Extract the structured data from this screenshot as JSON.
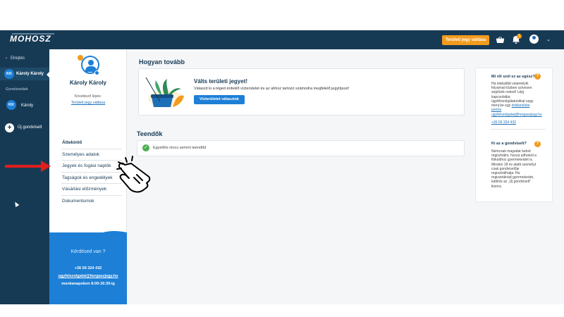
{
  "header": {
    "logo_text": "MOHOSZ",
    "cta_label": "Területi jegy váltása",
    "notification_count": "1",
    "icons": [
      "basket-icon",
      "bell-icon",
      "user-avatar-icon",
      "chevron-down-icon"
    ]
  },
  "rail": {
    "back_label": "Elrejtés",
    "active_user": {
      "initials": "KK",
      "name": "Károly Károly"
    },
    "section_label": "Gondviseltek",
    "ward": {
      "initials": "KK",
      "name": "Károly"
    },
    "add_label": "Új gondviselt"
  },
  "profile": {
    "name": "Károly Károly",
    "next_step_label": "Következő lépés:",
    "next_step_link": "Területi jegy váltása",
    "menu": [
      {
        "label": "Áttekintő",
        "active": true
      },
      {
        "label": "Személyes adatok",
        "active": false
      },
      {
        "label": "Jegyek és fogási naplók",
        "active": false
      },
      {
        "label": "Tagságok és engedélyek",
        "active": false
      },
      {
        "label": "Vásárlási előzmények",
        "active": false
      },
      {
        "label": "Dokumentumok",
        "active": false
      }
    ]
  },
  "help": {
    "title": "Kérdésed van ?",
    "phone": "+36 59 324 432",
    "email": "ugyfelszolgalat@horgaszjegy.hu",
    "hours": "munkanapokon 8:00-16:30-ig"
  },
  "main": {
    "next_title": "Hogyan tovább",
    "card_title": "Válts területi jegyet!",
    "card_text": "Válaszd ki a téged érdeklő vízterületet és az ahhoz tartozó számodra megfelelő jegytípust!",
    "card_button": "Vízterületet választok",
    "todo_title": "Teendők",
    "todo_text": "Egyelőre nincs semmi teendőd"
  },
  "info": {
    "q1_title": "Mi ről szól ez az egész?",
    "q1_text": "Ha elakadtál valamelyik folyamat közben szívesen segítünk neked! Lépj kapcsolatba ügyfélszolgálatunkkal vagy menj be egy ",
    "q1_link": "értékesítési pontra",
    "q1_email": "ugyfelszolgalat@horgaszjegy.hu",
    "q1_phone": "+36 59 324 432",
    "q2_title": "Ki az a gondviselt?",
    "q2_text": "Nemcsak magadat tudod regisztrálni, hozzá adhatod a fiókodhoz gyermekeidet is. Minden 18 év alatti személyt csak gondviselője regisztrálhatja. Ha regisztrálnád gyermekedet, kattints az „Új gondviselt” ikonra."
  }
}
